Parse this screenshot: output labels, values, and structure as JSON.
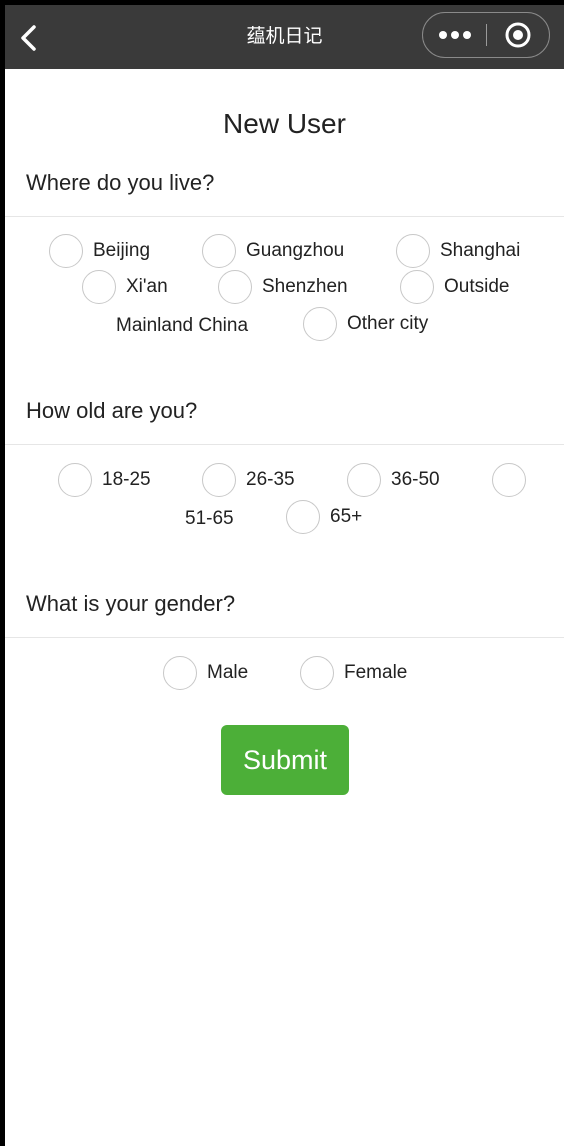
{
  "navbar": {
    "title": "蕴机日记",
    "back_icon": "chevron-left-icon",
    "more_icon": "more-dots-icon",
    "close_icon": "target-circle-icon"
  },
  "page": {
    "title": "New User"
  },
  "location": {
    "question": "Where do you live?",
    "options": [
      "Beijing",
      "Guangzhou",
      "Shanghai",
      "Xi'an",
      "Shenzhen",
      "Outside",
      "Mainland China",
      "Other city"
    ],
    "selected": null
  },
  "age": {
    "question": "How old are you?",
    "options": [
      "18-25",
      "26-35",
      "36-50",
      "51-65",
      "65+"
    ],
    "selected": null
  },
  "gender": {
    "question": "What is your gender?",
    "options": [
      "Male",
      "Female"
    ],
    "selected": null
  },
  "submit": {
    "label": "Submit",
    "color": "#4caf38"
  },
  "colors": {
    "navbar": "#3a3a3a",
    "background": "#ffffff",
    "accent": "#4caf38"
  }
}
